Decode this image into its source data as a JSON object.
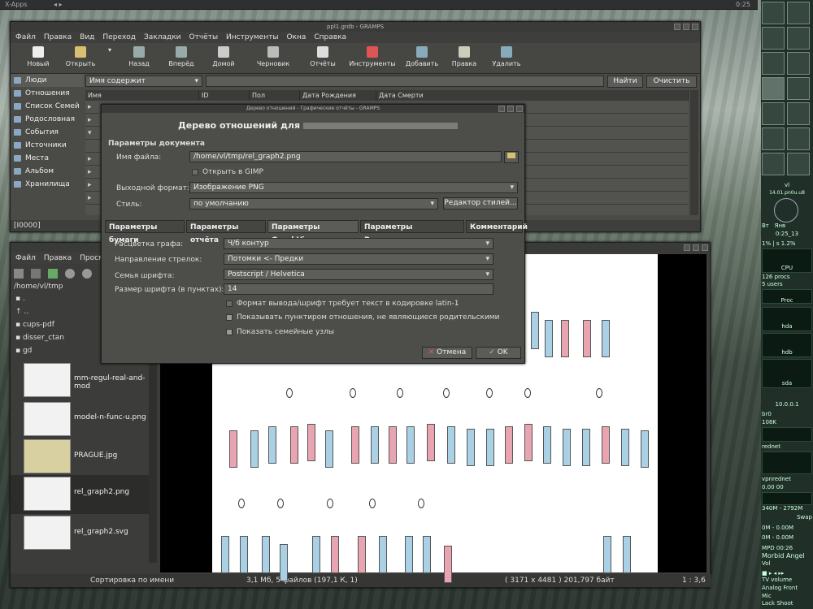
{
  "topbar": {
    "left": "X-Apps",
    "right": "0:25"
  },
  "gramps": {
    "title": "ppl1.grdb - GRAMPS",
    "menu": [
      "Файл",
      "Правка",
      "Вид",
      "Переход",
      "Закладки",
      "Отчёты",
      "Инструменты",
      "Окна",
      "Справка"
    ],
    "toolbar": [
      "Новый",
      "Открыть",
      "Назад",
      "Вперёд",
      "Домой",
      "Черновик",
      "Отчёты",
      "Инструменты",
      "Добавить",
      "Правка",
      "Удалить"
    ],
    "sidebar": [
      "Люди",
      "Отношения",
      "Список Семей",
      "Родословная",
      "События",
      "Источники",
      "Места",
      "Альбом",
      "Хранилища"
    ],
    "filter": {
      "combo": "Имя содержит",
      "find": "Найти",
      "clear": "Очистить"
    },
    "columns": [
      "Имя",
      "ID",
      "Пол",
      "Дата Рождения",
      "Дата Смерти"
    ],
    "status": "[I0000]"
  },
  "dialog": {
    "title": "Дерево отношений - Графические отчёты - GRAMPS",
    "heading": "Дерево отношений для",
    "section": "Параметры документа",
    "filename_label": "Имя файла:",
    "filename": "/home/vl/tmp/rel_graph2.png",
    "open_gimp": "Открыть в GIMP",
    "format_label": "Выходной формат:",
    "format": "Изображение PNG",
    "style_label": "Стиль:",
    "style": "по умолчанию",
    "style_editor": "Редактор стилей...",
    "tabs": [
      "Параметры бумаги",
      "Параметры отчёта",
      "Параметры GraphViz",
      "Параметры Разложения",
      "Комментарий"
    ],
    "color_label": "Расцветка графа:",
    "color": "Ч/б контур",
    "arrows_label": "Направление стрелок:",
    "arrows": "Потомки <- Предки",
    "font_label": "Семья шрифта:",
    "font": "Postscript / Helvetica",
    "size_label": "Размер шрифта (в пунктах):",
    "size": "14",
    "chk1": "Формат вывода/шрифт требует текст в кодировке latin-1",
    "chk2": "Показывать пунктиром отношения, не являющиеся родительскими",
    "chk3": "Показать семейные узлы",
    "cancel": "Отмена",
    "ok": "OK"
  },
  "viewer": {
    "menu": [
      "Файл",
      "Правка",
      "Просм"
    ],
    "path": "/home/vl/tmp",
    "dirs": [
      ".",
      "..",
      "cups-pdf",
      "disser_ctan",
      "gd"
    ],
    "files": [
      "mm-regul-real-and-mod",
      "model-n-func-u.png",
      "PRAGUE.jpg",
      "rel_graph2.png",
      "rel_graph2.svg"
    ],
    "status": [
      "Сортировка по имени",
      "3,1 Мб, 5 файлов (197,1 К, 1)",
      "( 3171 x 4481 ) 201,797 байт",
      "1 : 3,6"
    ]
  },
  "dock": {
    "host": "vl",
    "date": "14.01.pn0u.u8",
    "day": "Вт",
    "mon": "Янв",
    "time": "0:25_13",
    "cpu_line": "1% | s 1.2%",
    "cpu": "CPU",
    "procs": "126 procs",
    "users": "5 users",
    "proc": "Proc",
    "hda": "hda",
    "hdb": "hdb",
    "sda": "sda",
    "ip": "10.0.0.1",
    "br0": "br0",
    "rate": "108K",
    "rednet": "rednet",
    "vpn": "vpnrednet",
    "vpnv": "0.00 00",
    "mem": "340M - 2792M",
    "swap": "Swap",
    "m1": "0M - 0.00M",
    "m2": "0M - 0.00M",
    "mpd": "MPD 00:26",
    "song": "Morbid Angel",
    "vol": "Vol",
    "tv": "TV volume",
    "analog": "Analog Front",
    "mic": "Mic",
    "shoot": "Lack Shoot"
  }
}
